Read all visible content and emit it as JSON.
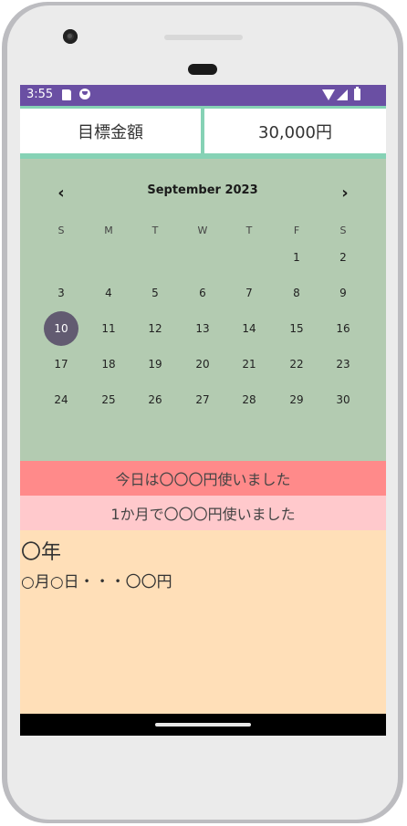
{
  "status": {
    "time": "3:55"
  },
  "goal": {
    "label": "目標金額",
    "value": "30,000円"
  },
  "calendar": {
    "month_title": "September 2023",
    "weekdays": [
      "S",
      "M",
      "T",
      "W",
      "T",
      "F",
      "S"
    ],
    "days": [
      "1",
      "2",
      "3",
      "4",
      "5",
      "6",
      "7",
      "8",
      "9",
      "10",
      "11",
      "12",
      "13",
      "14",
      "15",
      "16",
      "17",
      "18",
      "19",
      "20",
      "21",
      "22",
      "23",
      "24",
      "25",
      "26",
      "27",
      "28",
      "29",
      "30"
    ],
    "selected_day": "10",
    "selected_color": "#625b71"
  },
  "summary": {
    "today_text": "今日は〇〇〇円使いました",
    "month_text": "1か月で〇〇〇円使いました"
  },
  "log": {
    "year": "〇年",
    "entry": "○月○日・・・〇〇円"
  },
  "colors": {
    "status_bar": "#6a4fa3",
    "goal_border": "#86d2b5",
    "calendar_bg": "#b3cbb1",
    "today_bg": "#ff8a8a",
    "month_bg": "#ffc9cc",
    "log_bg": "#ffdfb8"
  },
  "icons": {
    "status": [
      "sd-card-icon",
      "face-icon",
      "wifi-icon",
      "signal-icon",
      "battery-icon"
    ],
    "calendar_nav": [
      "chevron-left-icon",
      "chevron-right-icon"
    ]
  }
}
